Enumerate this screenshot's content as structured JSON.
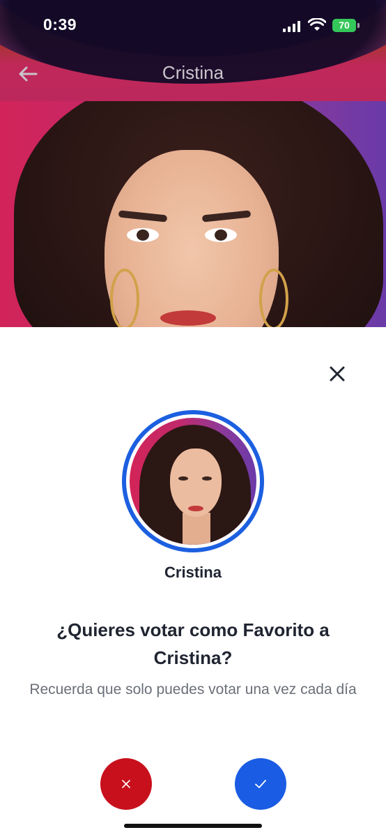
{
  "status_bar": {
    "time": "0:39",
    "battery": "70"
  },
  "nav": {
    "title": "Cristina",
    "back_icon": "arrow-left-icon"
  },
  "modal": {
    "close_icon": "close-icon",
    "contestant_name": "Cristina",
    "question": "¿Quieres votar como Favorito a Cristina?",
    "subtitle": "Recuerda que solo puedes votar una vez cada día",
    "cancel_icon": "x-icon",
    "confirm_icon": "check-icon"
  },
  "colors": {
    "accent_blue": "#1a5ce3",
    "cancel_red": "#c8101c",
    "battery_green": "#34c759"
  }
}
